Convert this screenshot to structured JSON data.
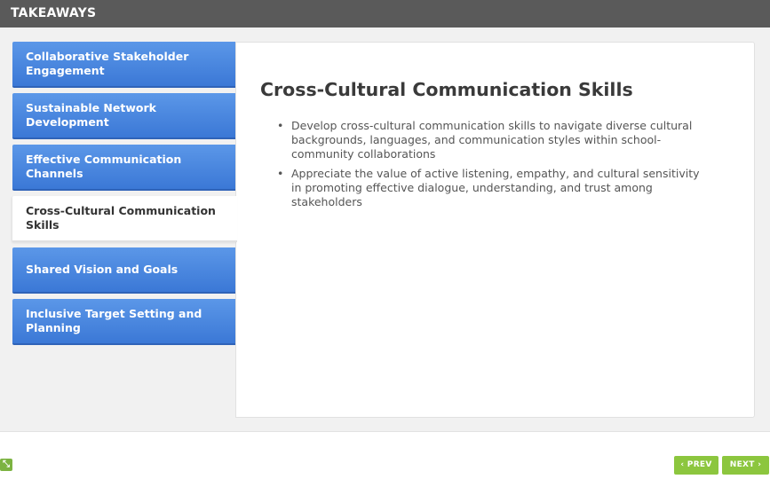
{
  "header": {
    "title": "TAKEAWAYS"
  },
  "tabs": [
    {
      "label": "Collaborative Stakeholder Engagement"
    },
    {
      "label": "Sustainable Network Development"
    },
    {
      "label": "Effective Communication Channels"
    },
    {
      "label": "Cross-Cultural Communication Skills"
    },
    {
      "label": "Shared Vision and Goals"
    },
    {
      "label": "Inclusive Target Setting and Planning"
    }
  ],
  "active_tab_index": 3,
  "panel": {
    "title": "Cross-Cultural Communication Skills",
    "bullets": [
      "Develop cross-cultural communication skills to navigate diverse cultural backgrounds, languages, and communication styles within school-community collaborations",
      "Appreciate the value of active listening, empathy, and cultural sensitivity in promoting effective dialogue, understanding, and trust among stakeholders"
    ]
  },
  "nav": {
    "prev_label": "PREV",
    "next_label": "NEXT",
    "prev_icon": "chevron-left-icon",
    "next_icon": "chevron-right-icon"
  },
  "colors": {
    "header_bg": "#5a5a5a",
    "tab_blue": "#4a87de",
    "nav_green": "#8cc63e"
  }
}
